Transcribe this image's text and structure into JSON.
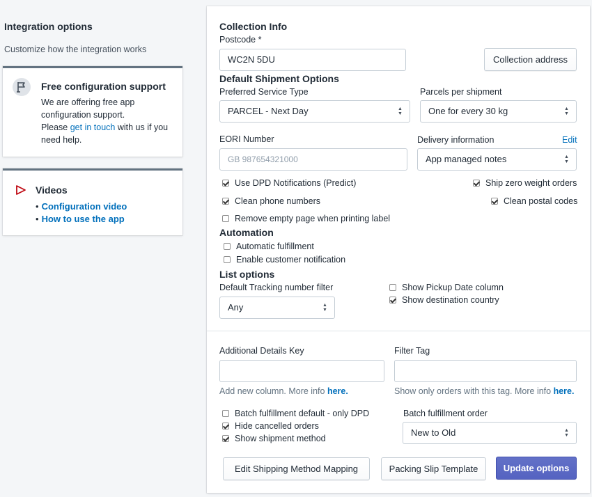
{
  "left": {
    "title": "Integration options",
    "description": "Customize how the integration works",
    "support_card": {
      "icon": "flag-icon",
      "title": "Free configuration support",
      "line1": "We are offering free app",
      "line2": "configuration support.",
      "line3_pre": "Please",
      "link": "get in touch",
      "line3_post": "with us if you",
      "line4": "need help."
    },
    "videos_card": {
      "icon": "play-icon",
      "title": "Videos",
      "bullet": "•",
      "items": [
        "Configuration video",
        "How to use the app"
      ]
    }
  },
  "collection": {
    "heading": "Collection Info",
    "postcode_label": "Postcode *",
    "postcode_value": "WC2N 5DU",
    "address_button": "Collection address"
  },
  "shipment": {
    "heading": "Default Shipment Options",
    "service_label": "Preferred Service Type",
    "service_value": "PARCEL - Next Day",
    "parcels_label": "Parcels per shipment",
    "parcels_value": "One for every 30 kg",
    "eori_label": "EORI Number",
    "eori_placeholder": "GB    987654321000",
    "delivery_label": "Delivery information",
    "delivery_edit": "Edit",
    "delivery_value": "App managed notes",
    "checks": [
      {
        "label": "Use DPD Notifications (Predict)",
        "checked": true
      },
      {
        "label": "Clean phone numbers",
        "checked": true
      },
      {
        "label": "Remove empty page when printing label",
        "checked": false
      },
      {
        "label": "Ship zero weight orders",
        "checked": true
      },
      {
        "label": "Clean postal codes",
        "checked": true
      }
    ]
  },
  "automation": {
    "heading": "Automation",
    "checks": [
      {
        "label": "Automatic fulfillment",
        "checked": false
      },
      {
        "label": "Enable customer notification",
        "checked": false
      }
    ]
  },
  "list_options": {
    "heading": "List options",
    "filter_label": "Default Tracking number filter",
    "filter_value": "Any",
    "checks": [
      {
        "label": "Show Pickup Date column",
        "checked": false
      },
      {
        "label": "Show destination country",
        "checked": true
      }
    ]
  },
  "extra": {
    "details_key_label": "Additional Details Key",
    "details_key_value": "",
    "details_help": "Add new column. More info",
    "details_help_link": "here.",
    "filter_tag_label": "Filter Tag",
    "filter_tag_value": "",
    "filter_help": "Show only orders with this tag. More info",
    "filter_help_link": "here.",
    "checks": [
      {
        "label": "Batch fulfillment default - only DPD",
        "checked": false
      },
      {
        "label": "Hide cancelled orders",
        "checked": true
      },
      {
        "label": "Show shipment method",
        "checked": true
      }
    ],
    "batch_order_label": "Batch fulfillment order",
    "batch_order_value": "New to Old"
  },
  "buttons": {
    "mapping": "Edit Shipping Method Mapping",
    "packing": "Packing Slip Template",
    "update": "Update options"
  },
  "colors": {
    "primary": "#5c6ac4",
    "link": "#006fbb",
    "accent_icon": "#bf0711"
  }
}
